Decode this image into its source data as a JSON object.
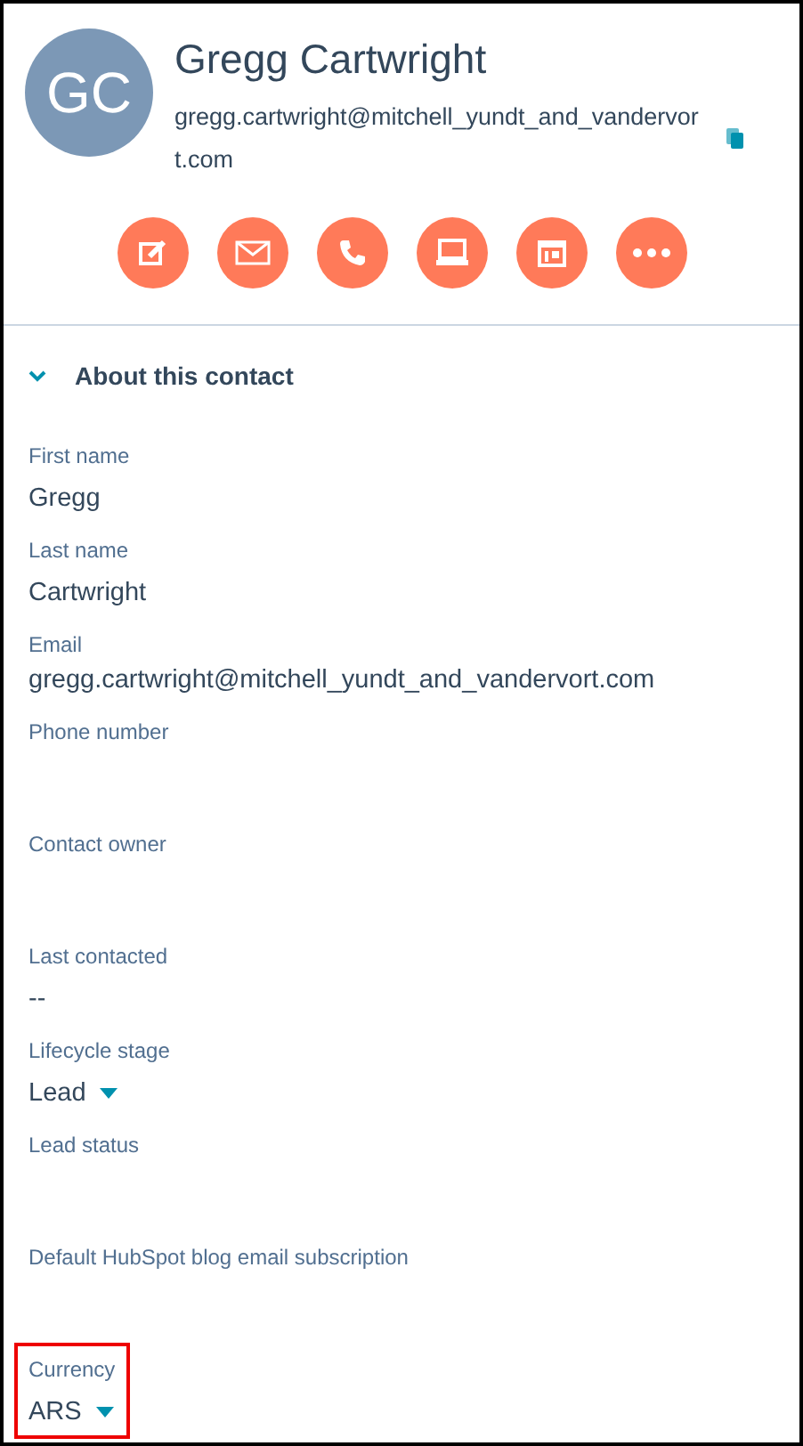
{
  "contact": {
    "initials": "GC",
    "name": "Gregg Cartwright",
    "email": "gregg.cartwright@mitchell_yundt_and_vandervort.com"
  },
  "actions": [
    {
      "kind": "note"
    },
    {
      "kind": "email"
    },
    {
      "kind": "call"
    },
    {
      "kind": "task"
    },
    {
      "kind": "meeting"
    },
    {
      "kind": "more"
    }
  ],
  "section": {
    "title": "About this contact",
    "expanded": true
  },
  "fields": [
    {
      "label": "First name",
      "value": "Gregg",
      "kind": "text",
      "highlighted": false
    },
    {
      "label": "Last name",
      "value": "Cartwright",
      "kind": "text",
      "highlighted": false
    },
    {
      "label": "Email",
      "value": "gregg.cartwright@mitchell_yundt_and_vandervort.com",
      "kind": "text",
      "highlighted": false
    },
    {
      "label": "Phone number",
      "kind": "empty",
      "highlighted": false
    },
    {
      "label": "Contact owner",
      "kind": "empty",
      "highlighted": false
    },
    {
      "label": "Last contacted",
      "value": "--",
      "kind": "text",
      "highlighted": false
    },
    {
      "label": "Lifecycle stage",
      "value": "Lead",
      "kind": "dropdown",
      "highlighted": false
    },
    {
      "label": "Lead status",
      "kind": "empty",
      "highlighted": false
    },
    {
      "label": "Default HubSpot blog email subscription",
      "kind": "empty",
      "highlighted": false
    },
    {
      "label": "Currency",
      "value": "ARS",
      "kind": "dropdown",
      "highlighted": true
    }
  ]
}
